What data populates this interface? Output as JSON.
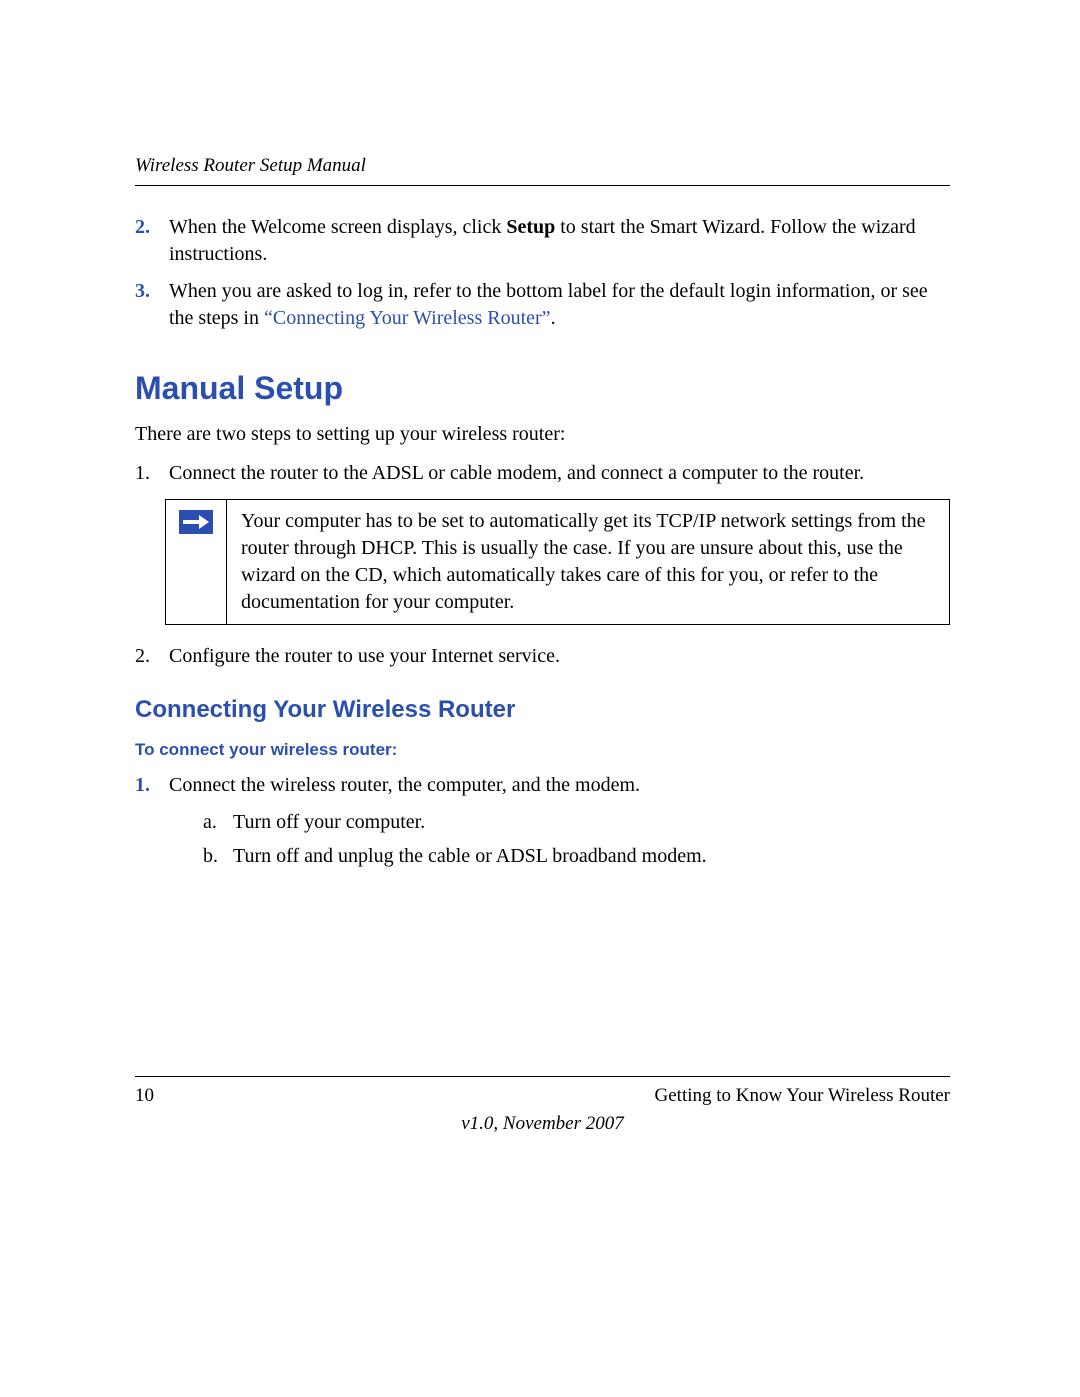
{
  "header": {
    "title": "Wireless Router Setup Manual"
  },
  "steps_top": [
    {
      "marker": "2.",
      "pre": "When the Welcome screen displays, click ",
      "bold": "Setup",
      "post": " to start the Smart Wizard. Follow the wizard instructions."
    },
    {
      "marker": "3.",
      "pre": "When you are asked to log in, refer to the bottom label for the default login information, or see the steps in ",
      "link": "“Connecting Your Wireless Router”",
      "post": "."
    }
  ],
  "h1": "Manual Setup",
  "intro": "There are two steps to setting up your wireless router:",
  "two_steps": {
    "s1": {
      "m": "1.",
      "t": "Connect the router to the ADSL or cable modem, and connect a computer to the router."
    },
    "s2": {
      "m": "2.",
      "t": "Configure the router to use your Internet service."
    }
  },
  "note": "Your computer has to be set to automatically get its TCP/IP network settings from the router through DHCP. This is usually the case. If you are unsure about this, use the wizard on the CD, which automatically takes care of this for you, or refer to the documentation for your computer.",
  "h2": "Connecting Your Wireless Router",
  "h3": "To connect your wireless router:",
  "connect": {
    "m": "1.",
    "t": "Connect the wireless router, the computer, and the modem.",
    "a": {
      "m": "a.",
      "t": "Turn off your computer."
    },
    "b": {
      "m": "b.",
      "t": "Turn off and unplug the cable or ADSL broadband modem."
    }
  },
  "footer": {
    "page": "10",
    "section": "Getting to Know Your Wireless Router",
    "version": "v1.0, November 2007"
  }
}
